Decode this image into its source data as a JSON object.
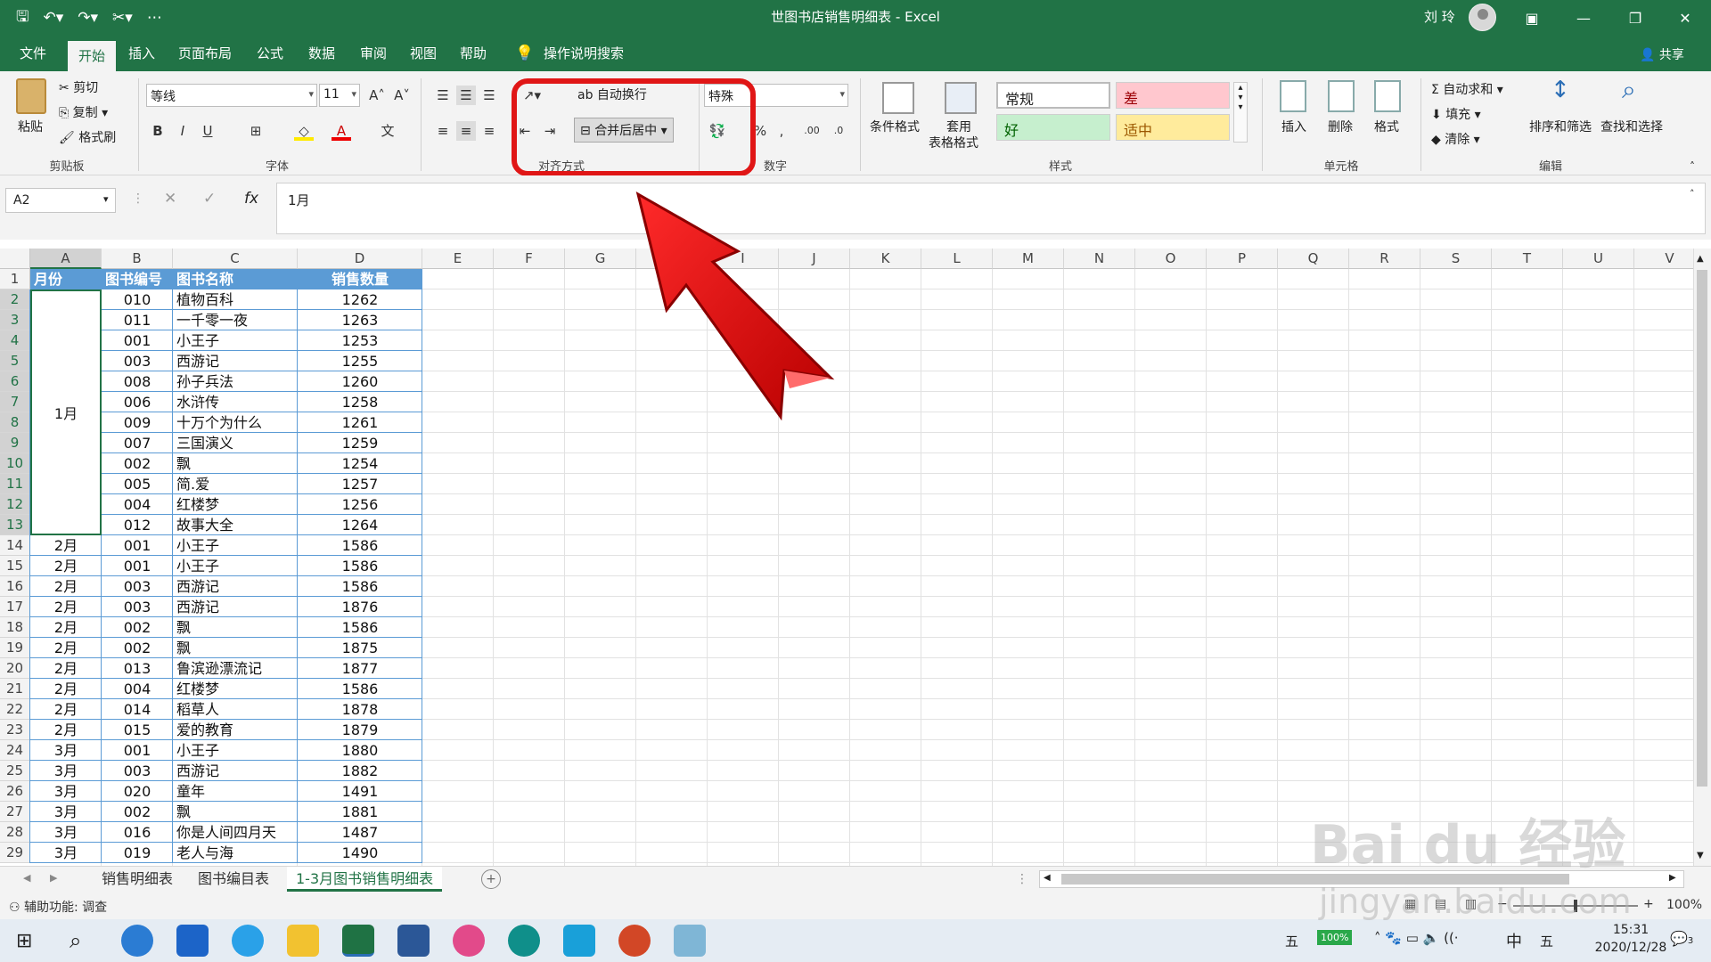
{
  "title": {
    "window_title": "世图书店销售明细表 - Excel",
    "user_name": "刘 玲",
    "qat_expand": "⋯"
  },
  "menu": {
    "tabs": [
      "文件",
      "开始",
      "插入",
      "页面布局",
      "公式",
      "数据",
      "审阅",
      "视图",
      "帮助"
    ],
    "search_label": "操作说明搜索",
    "share_label": "共享"
  },
  "ribbon": {
    "clipboard": {
      "paste": "粘贴",
      "cut": "剪切",
      "copy": "复制",
      "format_painter": "格式刷",
      "group": "剪贴板"
    },
    "font": {
      "name": "等线",
      "size": "11",
      "bold": "B",
      "italic": "I",
      "underline": "U",
      "group": "字体"
    },
    "alignment": {
      "wrap": "自动换行",
      "merge": "合并后居中",
      "group": "对齐方式"
    },
    "number": {
      "format": "特殊",
      "group": "数字"
    },
    "styles": {
      "conditional": "条件格式",
      "table_format_1": "套用",
      "table_format_2": "表格格式",
      "normal": "常规",
      "bad": "差",
      "good": "好",
      "neutral": "适中",
      "group": "样式"
    },
    "cells": {
      "insert": "插入",
      "delete": "删除",
      "format": "格式",
      "group": "单元格"
    },
    "editing": {
      "autosum": "自动求和",
      "fill": "填充",
      "clear": "清除",
      "sort": "排序和筛选",
      "find": "查找和选择",
      "group": "编辑"
    }
  },
  "formula_bar": {
    "name_box": "A2",
    "formula": "1月",
    "fx": "fx"
  },
  "columns": [
    "A",
    "B",
    "C",
    "D",
    "E",
    "F",
    "G",
    "H",
    "I",
    "J",
    "K",
    "L",
    "M",
    "N",
    "O",
    "P",
    "Q",
    "R",
    "S",
    "T",
    "U",
    "V"
  ],
  "row_numbers": [
    "1",
    "2",
    "3",
    "4",
    "5",
    "6",
    "7",
    "8",
    "9",
    "10",
    "11",
    "12",
    "13",
    "14",
    "15",
    "16",
    "17",
    "18",
    "19",
    "20",
    "21",
    "22",
    "23",
    "24",
    "25",
    "26",
    "27",
    "28",
    "29"
  ],
  "table_header": {
    "month": "月份",
    "book_id": "图书编号",
    "book_name": "图书名称",
    "sales": "销售数量"
  },
  "merged_month": "1月",
  "rows": [
    {
      "month": "",
      "id": "010",
      "name": "植物百科",
      "sales": "1262"
    },
    {
      "month": "",
      "id": "011",
      "name": "一千零一夜",
      "sales": "1263"
    },
    {
      "month": "",
      "id": "001",
      "name": "小王子",
      "sales": "1253"
    },
    {
      "month": "",
      "id": "003",
      "name": "西游记",
      "sales": "1255"
    },
    {
      "month": "",
      "id": "008",
      "name": "孙子兵法",
      "sales": "1260"
    },
    {
      "month": "",
      "id": "006",
      "name": "水浒传",
      "sales": "1258"
    },
    {
      "month": "",
      "id": "009",
      "name": "十万个为什么",
      "sales": "1261"
    },
    {
      "month": "",
      "id": "007",
      "name": "三国演义",
      "sales": "1259"
    },
    {
      "month": "",
      "id": "002",
      "name": "飘",
      "sales": "1254"
    },
    {
      "month": "",
      "id": "005",
      "name": "简.爱",
      "sales": "1257"
    },
    {
      "month": "",
      "id": "004",
      "name": "红楼梦",
      "sales": "1256"
    },
    {
      "month": "",
      "id": "012",
      "name": "故事大全",
      "sales": "1264"
    },
    {
      "month": "2月",
      "id": "001",
      "name": "小王子",
      "sales": "1586"
    },
    {
      "month": "2月",
      "id": "001",
      "name": "小王子",
      "sales": "1586"
    },
    {
      "month": "2月",
      "id": "003",
      "name": "西游记",
      "sales": "1586"
    },
    {
      "month": "2月",
      "id": "003",
      "name": "西游记",
      "sales": "1876"
    },
    {
      "month": "2月",
      "id": "002",
      "name": "飘",
      "sales": "1586"
    },
    {
      "month": "2月",
      "id": "002",
      "name": "飘",
      "sales": "1875"
    },
    {
      "month": "2月",
      "id": "013",
      "name": "鲁滨逊漂流记",
      "sales": "1877"
    },
    {
      "month": "2月",
      "id": "004",
      "name": "红楼梦",
      "sales": "1586"
    },
    {
      "month": "2月",
      "id": "014",
      "name": "稻草人",
      "sales": "1878"
    },
    {
      "month": "2月",
      "id": "015",
      "name": "爱的教育",
      "sales": "1879"
    },
    {
      "month": "3月",
      "id": "001",
      "name": "小王子",
      "sales": "1880"
    },
    {
      "month": "3月",
      "id": "003",
      "name": "西游记",
      "sales": "1882"
    },
    {
      "month": "3月",
      "id": "020",
      "name": "童年",
      "sales": "1491"
    },
    {
      "month": "3月",
      "id": "002",
      "name": "飘",
      "sales": "1881"
    },
    {
      "month": "3月",
      "id": "016",
      "name": "你是人间四月天",
      "sales": "1487"
    },
    {
      "month": "3月",
      "id": "019",
      "name": "老人与海",
      "sales": "1490"
    }
  ],
  "sheets": [
    "销售明细表",
    "图书编目表",
    "1-3月图书销售明细表"
  ],
  "status": {
    "accessibility": "辅助功能: 调查",
    "zoom": "100%"
  },
  "taskbar": {
    "time": "15:31",
    "date": "2020/12/28",
    "ime": "中",
    "ime2": "五",
    "battery": "100%",
    "notif": "3"
  },
  "watermark": {
    "logo": "Bai du 经验",
    "url": "jingyan.baidu.com"
  },
  "colors": {
    "excel_green": "#217346",
    "table_blue": "#5b9bd5",
    "highlight_red": "#e01616"
  }
}
